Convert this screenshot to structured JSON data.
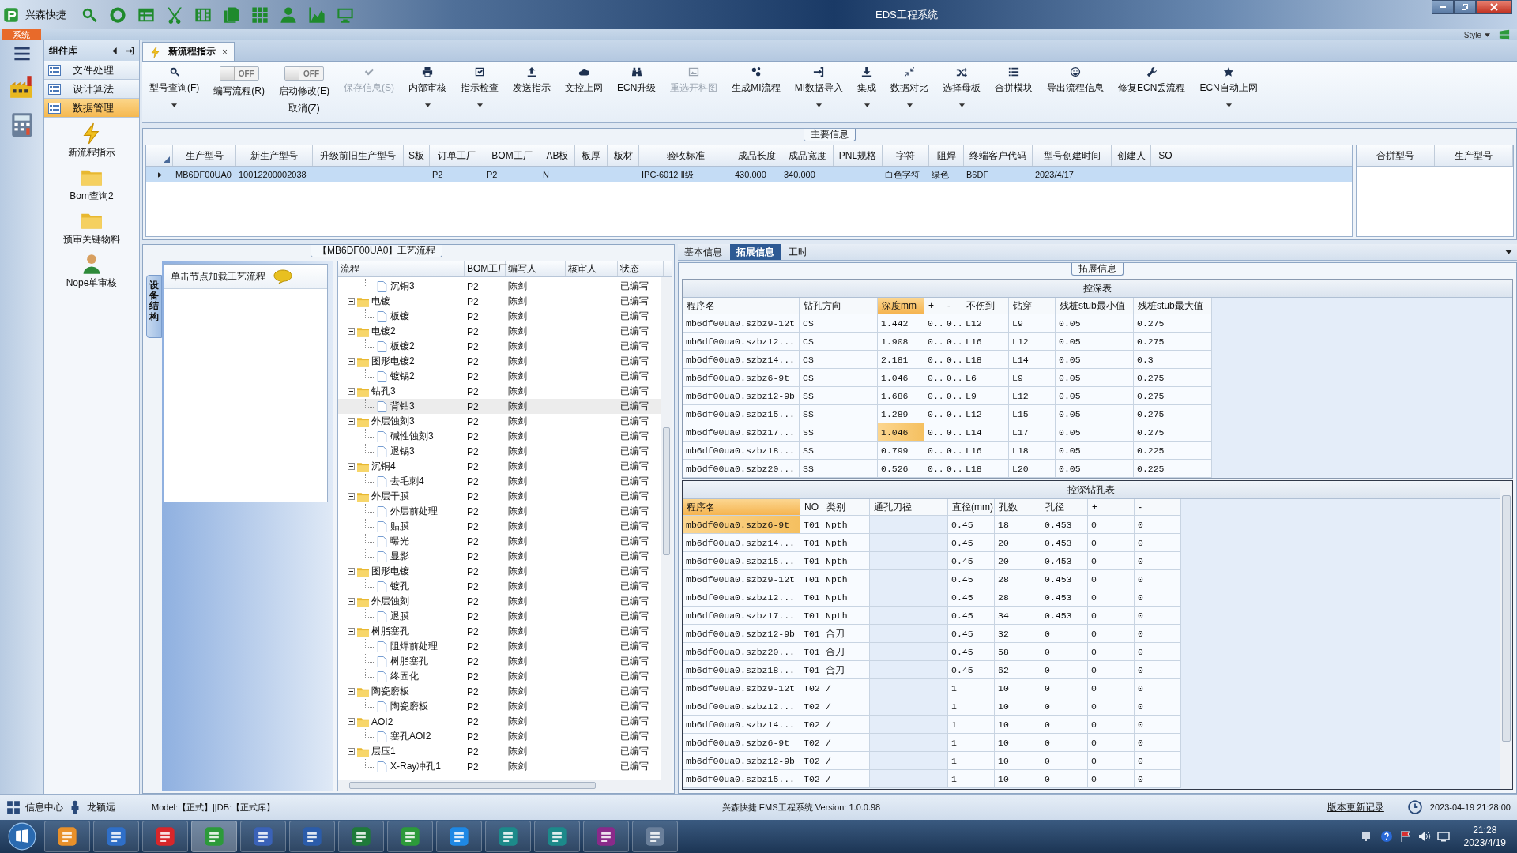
{
  "title_bar": {
    "app_name": "兴森快捷",
    "title": "EDS工程系统"
  },
  "ribbon": {
    "tab": "系统",
    "style_menu": "Style"
  },
  "sidebar": {
    "header": "组件库",
    "menu": [
      {
        "label": "文件处理",
        "selected": false
      },
      {
        "label": "设计算法",
        "selected": false
      },
      {
        "label": "数据管理",
        "selected": true
      }
    ],
    "shortcuts": [
      {
        "label": "新流程指示"
      },
      {
        "label": "Bom查询2"
      },
      {
        "label": "预审关键物料"
      },
      {
        "label": "Nope单审核"
      }
    ]
  },
  "document_tab": {
    "title": "新流程指示",
    "close": "×"
  },
  "toolbar": [
    {
      "kind": "button",
      "label": "型号查询(F)",
      "dropdown": true,
      "disabled": false
    },
    {
      "kind": "toggle",
      "label": "编写流程(R)",
      "switch_text": "OFF",
      "on": false
    },
    {
      "kind": "toggle",
      "label": "启动修改(E)",
      "sublabel": "取消(Z)",
      "switch_text": "OFF",
      "on": false
    },
    {
      "kind": "button",
      "label": "保存信息(S)",
      "dropdown": false,
      "disabled": true
    },
    {
      "kind": "button",
      "label": "内部审核",
      "dropdown": true,
      "disabled": false
    },
    {
      "kind": "button",
      "label": "指示检查",
      "dropdown": true,
      "disabled": false
    },
    {
      "kind": "button",
      "label": "发送指示",
      "dropdown": false,
      "disabled": false
    },
    {
      "kind": "button",
      "label": "文控上网",
      "dropdown": false,
      "disabled": false
    },
    {
      "kind": "button",
      "label": "ECN升级",
      "dropdown": false,
      "disabled": false
    },
    {
      "kind": "button",
      "label": "重选开料图",
      "dropdown": false,
      "disabled": true
    },
    {
      "kind": "button",
      "label": "生成MI流程",
      "dropdown": false,
      "disabled": false
    },
    {
      "kind": "button",
      "label": "MI数据导入",
      "dropdown": true,
      "disabled": false
    },
    {
      "kind": "button",
      "label": "集成",
      "dropdown": true,
      "disabled": false
    },
    {
      "kind": "button",
      "label": "数据对比",
      "dropdown": true,
      "disabled": false
    },
    {
      "kind": "button",
      "label": "选择母板",
      "dropdown": true,
      "disabled": false
    },
    {
      "kind": "button",
      "label": "合拼模块",
      "dropdown": false,
      "disabled": false
    },
    {
      "kind": "button",
      "label": "导出流程信息",
      "dropdown": false,
      "disabled": false
    },
    {
      "kind": "button",
      "label": "修复ECN丢流程",
      "dropdown": false,
      "disabled": false
    },
    {
      "kind": "button",
      "label": "ECN自动上网",
      "dropdown": true,
      "disabled": false
    }
  ],
  "main_info": {
    "title": "主要信息",
    "columns": [
      "生产型号",
      "新生产型号",
      "升级前旧生产型号",
      "S板",
      "订单工厂",
      "BOM工厂",
      "AB板",
      "板厚",
      "板材",
      "验收标准",
      "成品长度",
      "成品宽度",
      "PNL规格",
      "字符",
      "阻焊",
      "终端客户代码",
      "型号创建时间",
      "创建人",
      "SO"
    ],
    "rows": [
      {
        "selected": true,
        "cells": [
          "MB6DF00UA0",
          "10012200002038",
          null,
          null,
          "P2",
          "P2",
          "N",
          null,
          null,
          "IPC-6012 Ⅱ级",
          "430.000",
          "340.000",
          null,
          "白色字符",
          "绿色",
          "B6DF",
          "2023/4/17",
          null,
          null
        ]
      }
    ],
    "merge_table": {
      "columns": [
        "合拼型号",
        "生产型号"
      ]
    }
  },
  "process_panel": {
    "title": "【MB6DF00UA0】工艺流程",
    "side_tab": "设备结构",
    "hint": "单击节点加载工艺流程",
    "columns": [
      "流程",
      "BOM工厂",
      "编写人",
      "核审人",
      "状态"
    ],
    "tree": [
      {
        "name": "沉铜3",
        "bom": "P2",
        "writer": "陈剑",
        "status": "已编写",
        "selected": false
      },
      {
        "name": "电镀",
        "bom": "P2",
        "writer": "陈剑",
        "status": "已编写",
        "selected": false,
        "expanded": true,
        "children": [
          {
            "name": "板镀",
            "bom": "P2",
            "writer": "陈剑",
            "status": "已编写",
            "selected": false
          }
        ]
      },
      {
        "name": "电镀2",
        "bom": "P2",
        "writer": "陈剑",
        "status": "已编写",
        "selected": false,
        "expanded": true,
        "children": [
          {
            "name": "板镀2",
            "bom": "P2",
            "writer": "陈剑",
            "status": "已编写",
            "selected": false
          }
        ]
      },
      {
        "name": "图形电镀2",
        "bom": "P2",
        "writer": "陈剑",
        "status": "已编写",
        "selected": false,
        "expanded": true,
        "children": [
          {
            "name": "镀锡2",
            "bom": "P2",
            "writer": "陈剑",
            "status": "已编写",
            "selected": false
          }
        ]
      },
      {
        "name": "钻孔3",
        "bom": "P2",
        "writer": "陈剑",
        "status": "已编写",
        "selected": false,
        "expanded": true,
        "children": [
          {
            "name": "背钻3",
            "bom": "P2",
            "writer": "陈剑",
            "status": "已编写",
            "selected": true
          }
        ]
      },
      {
        "name": "外层蚀刻3",
        "bom": "P2",
        "writer": "陈剑",
        "status": "已编写",
        "selected": false,
        "expanded": true,
        "children": [
          {
            "name": "碱性蚀刻3",
            "bom": "P2",
            "writer": "陈剑",
            "status": "已编写",
            "selected": false
          },
          {
            "name": "退锡3",
            "bom": "P2",
            "writer": "陈剑",
            "status": "已编写",
            "selected": false
          }
        ]
      },
      {
        "name": "沉铜4",
        "bom": "P2",
        "writer": "陈剑",
        "status": "已编写",
        "selected": false,
        "expanded": true,
        "children": [
          {
            "name": "去毛刺4",
            "bom": "P2",
            "writer": "陈剑",
            "status": "已编写",
            "selected": false
          }
        ]
      },
      {
        "name": "外层干膜",
        "bom": "P2",
        "writer": "陈剑",
        "status": "已编写",
        "selected": false,
        "expanded": true,
        "children": [
          {
            "name": "外层前处理",
            "bom": "P2",
            "writer": "陈剑",
            "status": "已编写",
            "selected": false
          },
          {
            "name": "贴膜",
            "bom": "P2",
            "writer": "陈剑",
            "status": "已编写",
            "selected": false
          },
          {
            "name": "曝光",
            "bom": "P2",
            "writer": "陈剑",
            "status": "已编写",
            "selected": false
          },
          {
            "name": "显影",
            "bom": "P2",
            "writer": "陈剑",
            "status": "已编写",
            "selected": false
          }
        ]
      },
      {
        "name": "图形电镀",
        "bom": "P2",
        "writer": "陈剑",
        "status": "已编写",
        "selected": false,
        "expanded": true,
        "children": [
          {
            "name": "镀孔",
            "bom": "P2",
            "writer": "陈剑",
            "status": "已编写",
            "selected": false
          }
        ]
      },
      {
        "name": "外层蚀刻",
        "bom": "P2",
        "writer": "陈剑",
        "status": "已编写",
        "selected": false,
        "expanded": true,
        "children": [
          {
            "name": "退膜",
            "bom": "P2",
            "writer": "陈剑",
            "status": "已编写",
            "selected": false
          }
        ]
      },
      {
        "name": "树脂塞孔",
        "bom": "P2",
        "writer": "陈剑",
        "status": "已编写",
        "selected": false,
        "expanded": true,
        "children": [
          {
            "name": "阻焊前处理",
            "bom": "P2",
            "writer": "陈剑",
            "status": "已编写",
            "selected": false
          },
          {
            "name": "树脂塞孔",
            "bom": "P2",
            "writer": "陈剑",
            "status": "已编写",
            "selected": false
          },
          {
            "name": "终固化",
            "bom": "P2",
            "writer": "陈剑",
            "status": "已编写",
            "selected": false
          }
        ]
      },
      {
        "name": "陶瓷磨板",
        "bom": "P2",
        "writer": "陈剑",
        "status": "已编写",
        "selected": false,
        "expanded": true,
        "children": [
          {
            "name": "陶瓷磨板",
            "bom": "P2",
            "writer": "陈剑",
            "status": "已编写",
            "selected": false
          }
        ]
      },
      {
        "name": "AOI2",
        "bom": "P2",
        "writer": "陈剑",
        "status": "已编写",
        "selected": false,
        "expanded": true,
        "children": [
          {
            "name": "塞孔AOI2",
            "bom": "P2",
            "writer": "陈剑",
            "status": "已编写",
            "selected": false
          }
        ]
      },
      {
        "name": "层压1",
        "bom": "P2",
        "writer": "陈剑",
        "status": "已编写",
        "selected": false,
        "expanded": true,
        "children": [
          {
            "name": "X-Ray冲孔1",
            "bom": "P2",
            "writer": "陈剑",
            "status": "已编写",
            "selected": false
          }
        ]
      }
    ]
  },
  "detail_panel": {
    "tabs": [
      {
        "label": "基本信息",
        "selected": false
      },
      {
        "label": "拓展信息",
        "selected": true
      },
      {
        "label": "工时",
        "selected": false
      }
    ],
    "group_title": "拓展信息",
    "depth_table": {
      "title": "控深表",
      "columns": [
        {
          "label": "程序名",
          "selected": false
        },
        {
          "label": "钻孔方向",
          "selected": false
        },
        {
          "label": "深度mm",
          "selected": true
        },
        {
          "label": "+",
          "selected": false
        },
        {
          "label": "-",
          "selected": false
        },
        {
          "label": "不伤到",
          "selected": false
        },
        {
          "label": "钻穿",
          "selected": false
        },
        {
          "label": "残桩stub最小值",
          "selected": false
        },
        {
          "label": "残桩stub最大值",
          "selected": false
        }
      ],
      "rows": [
        {
          "selected": false,
          "cells": [
            "mb6df00ua0.szbz9-12t",
            "CS",
            "1.442",
            "0..",
            "0..",
            "L12",
            "L9",
            "0.05",
            "0.275"
          ]
        },
        {
          "selected": false,
          "cells": [
            "mb6df00ua0.szbz12...",
            "CS",
            "1.908",
            "0..",
            "0..",
            "L16",
            "L12",
            "0.05",
            "0.275"
          ]
        },
        {
          "selected": false,
          "cells": [
            "mb6df00ua0.szbz14...",
            "CS",
            "2.181",
            "0..",
            "0..",
            "L18",
            "L14",
            "0.05",
            "0.3"
          ]
        },
        {
          "selected": false,
          "cells": [
            "mb6df00ua0.szbz6-9t",
            "CS",
            "1.046",
            "0..",
            "0..",
            "L6",
            "L9",
            "0.05",
            "0.275"
          ]
        },
        {
          "selected": false,
          "cells": [
            "mb6df00ua0.szbz12-9b",
            "SS",
            "1.686",
            "0..",
            "0..",
            "L9",
            "L12",
            "0.05",
            "0.275"
          ]
        },
        {
          "selected": false,
          "cells": [
            "mb6df00ua0.szbz15...",
            "SS",
            "1.289",
            "0..",
            "0..",
            "L12",
            "L15",
            "0.05",
            "0.275"
          ]
        },
        {
          "selected": true,
          "cells": [
            "mb6df00ua0.szbz17...",
            "SS",
            "1.046",
            "0..",
            "0..",
            "L14",
            "L17",
            "0.05",
            "0.275"
          ]
        },
        {
          "selected": false,
          "cells": [
            "mb6df00ua0.szbz18...",
            "SS",
            "0.799",
            "0..",
            "0..",
            "L16",
            "L18",
            "0.05",
            "0.225"
          ]
        },
        {
          "selected": false,
          "cells": [
            "mb6df00ua0.szbz20...",
            "SS",
            "0.526",
            "0..",
            "0..",
            "L18",
            "L20",
            "0.05",
            "0.225"
          ]
        }
      ]
    },
    "drill_table": {
      "title": "控深钻孔表",
      "columns": [
        {
          "label": "程序名",
          "selected": true
        },
        {
          "label": "NO",
          "selected": false
        },
        {
          "label": "类别",
          "selected": false
        },
        {
          "label": "通孔刀径",
          "selected": false
        },
        {
          "label": "直径(mm)",
          "selected": false
        },
        {
          "label": "孔数",
          "selected": false
        },
        {
          "label": "孔径",
          "selected": false
        },
        {
          "label": "+",
          "selected": false
        },
        {
          "label": "-",
          "selected": false
        }
      ],
      "rows": [
        {
          "selected": true,
          "cells": [
            "mb6df00ua0.szbz6-9t",
            "T01",
            "Npth",
            null,
            "0.45",
            "18",
            "0.453",
            "0",
            "0"
          ]
        },
        {
          "selected": false,
          "cells": [
            "mb6df00ua0.szbz14...",
            "T01",
            "Npth",
            null,
            "0.45",
            "20",
            "0.453",
            "0",
            "0"
          ]
        },
        {
          "selected": false,
          "cells": [
            "mb6df00ua0.szbz15...",
            "T01",
            "Npth",
            null,
            "0.45",
            "20",
            "0.453",
            "0",
            "0"
          ]
        },
        {
          "selected": false,
          "cells": [
            "mb6df00ua0.szbz9-12t",
            "T01",
            "Npth",
            null,
            "0.45",
            "28",
            "0.453",
            "0",
            "0"
          ]
        },
        {
          "selected": false,
          "cells": [
            "mb6df00ua0.szbz12...",
            "T01",
            "Npth",
            null,
            "0.45",
            "28",
            "0.453",
            "0",
            "0"
          ]
        },
        {
          "selected": false,
          "cells": [
            "mb6df00ua0.szbz17...",
            "T01",
            "Npth",
            null,
            "0.45",
            "34",
            "0.453",
            "0",
            "0"
          ]
        },
        {
          "selected": false,
          "cells": [
            "mb6df00ua0.szbz12-9b",
            "T01",
            "合刀",
            null,
            "0.45",
            "32",
            "0",
            "0",
            "0"
          ]
        },
        {
          "selected": false,
          "cells": [
            "mb6df00ua0.szbz20...",
            "T01",
            "合刀",
            null,
            "0.45",
            "58",
            "0",
            "0",
            "0"
          ]
        },
        {
          "selected": false,
          "cells": [
            "mb6df00ua0.szbz18...",
            "T01",
            "合刀",
            null,
            "0.45",
            "62",
            "0",
            "0",
            "0"
          ]
        },
        {
          "selected": false,
          "cells": [
            "mb6df00ua0.szbz9-12t",
            "T02",
            "/",
            null,
            "1",
            "10",
            "0",
            "0",
            "0"
          ]
        },
        {
          "selected": false,
          "cells": [
            "mb6df00ua0.szbz12...",
            "T02",
            "/",
            null,
            "1",
            "10",
            "0",
            "0",
            "0"
          ]
        },
        {
          "selected": false,
          "cells": [
            "mb6df00ua0.szbz14...",
            "T02",
            "/",
            null,
            "1",
            "10",
            "0",
            "0",
            "0"
          ]
        },
        {
          "selected": false,
          "cells": [
            "mb6df00ua0.szbz6-9t",
            "T02",
            "/",
            null,
            "1",
            "10",
            "0",
            "0",
            "0"
          ]
        },
        {
          "selected": false,
          "cells": [
            "mb6df00ua0.szbz12-9b",
            "T02",
            "/",
            null,
            "1",
            "10",
            "0",
            "0",
            "0"
          ]
        },
        {
          "selected": false,
          "cells": [
            "mb6df00ua0.szbz15...",
            "T02",
            "/",
            null,
            "1",
            "10",
            "0",
            "0",
            "0"
          ]
        }
      ]
    }
  },
  "status_bar": {
    "info_center": "信息中心",
    "user": "龙颖远",
    "model_db": "Model:【正式】||DB:【正式库】",
    "version": "兴森快捷 EMS工程系统 Version: 1.0.0.98",
    "update_log": "版本更新记录",
    "datetime": "2023-04-19 21:28:00"
  },
  "taskbar": {
    "time": "21:28",
    "date": "2023/4/19"
  }
}
